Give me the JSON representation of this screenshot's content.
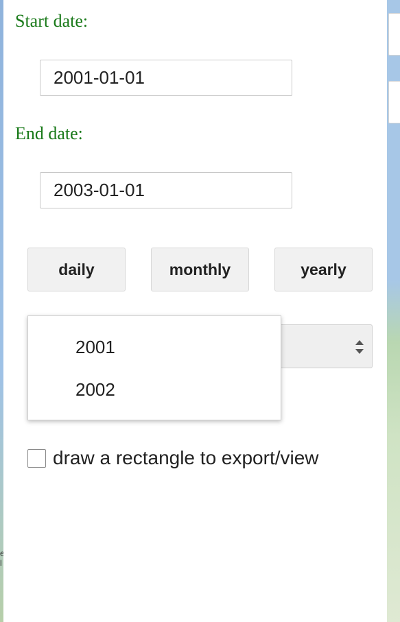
{
  "form": {
    "start_label": "Start date:",
    "start_value": "2001-01-01",
    "end_label": "End date:",
    "end_value": "2003-01-01"
  },
  "interval_buttons": {
    "daily": "daily",
    "monthly": "monthly",
    "yearly": "yearly"
  },
  "year_select": {
    "options": [
      "2001",
      "2002"
    ]
  },
  "rectangle_checkbox": {
    "label": "draw a rectangle to export/view",
    "checked": false
  },
  "map": {
    "side_text": "e\nl"
  },
  "colors": {
    "label_green": "#1a7a1a",
    "button_bg": "#f1f1f1"
  }
}
